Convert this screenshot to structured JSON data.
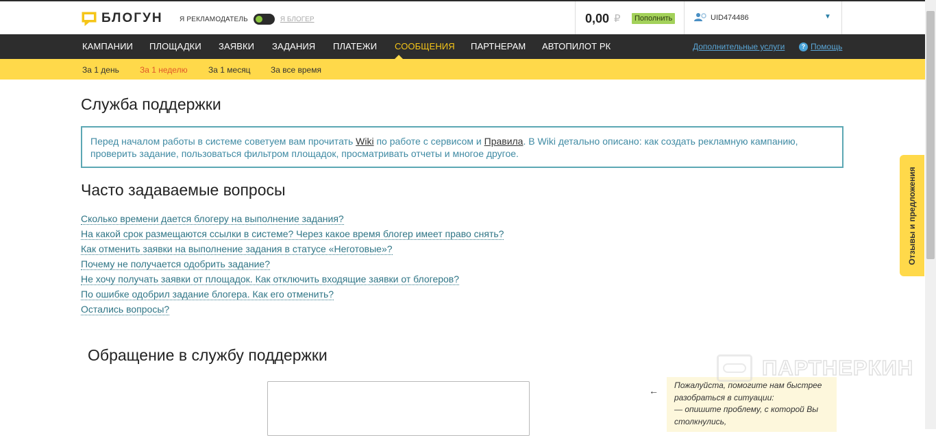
{
  "header": {
    "logo_text": "БЛОГУН",
    "role_advertiser": "Я РЕКЛАМОДАТЕЛЬ",
    "role_blogger": "Я БЛОГЕР",
    "balance": "0,00",
    "currency": "₽",
    "topup_label": "Пополнить",
    "user_id": "UID474486"
  },
  "nav": {
    "items": [
      "КАМПАНИИ",
      "ПЛОЩАДКИ",
      "ЗАЯВКИ",
      "ЗАДАНИЯ",
      "ПЛАТЕЖИ",
      "СООБЩЕНИЯ",
      "ПАРТНЕРАМ",
      "АВТОПИЛОТ РК"
    ],
    "active_item": "СООБЩЕНИЯ",
    "extra_services": "Дополнительные услуги",
    "help": "Помощь"
  },
  "subnav": {
    "items": [
      "За 1 день",
      "За 1 неделю",
      "За 1 месяц",
      "За все время"
    ],
    "active_item": "За 1 неделю"
  },
  "page": {
    "title": "Служба поддержки",
    "notice_before_wiki": "Перед началом работы в системе советуем вам прочитать ",
    "notice_wiki_link": "Wiki",
    "notice_middle": " по работе с сервисом и ",
    "notice_rules_link": "Правила",
    "notice_after": ". В Wiki детально описано: как создать рекламную кампанию, проверить задание, пользоваться фильтром площадок, просматривать отчеты и многое другое.",
    "faq_title": "Часто задаваемые вопросы",
    "faq": [
      "Сколько времени дается блогеру на выполнение задания?",
      "На какой срок размещаются ссылки в системе? Через какое время блогер имеет право снять?",
      "Как отменить заявки на выполнение задания в статусе «Неготовые»?",
      "Почему не получается одобрить задание?",
      "Не хочу получать заявки от площадок. Как отключить входящие заявки от блогеров?",
      "По ошибке одобрил задание блогера. Как его отменить?",
      "Остались вопросы?"
    ],
    "support_title": "Обращение в службу поддержки",
    "hint_arrow": "←",
    "hint_lines": [
      "Пожалуйста, помогите нам быстрее",
      "разобраться в ситуации:",
      "— опишите проблему, с которой Вы",
      "столкнулись,"
    ]
  },
  "feedback_tab": "Отзывы и предложения",
  "watermark": "ПАРТНЕРКИН",
  "colors": {
    "nav_bg": "#2d2d2d",
    "accent_yellow": "#ffd94a",
    "active_nav": "#f5c518",
    "notice_border": "#5ba7b3",
    "link": "#2f7586"
  }
}
